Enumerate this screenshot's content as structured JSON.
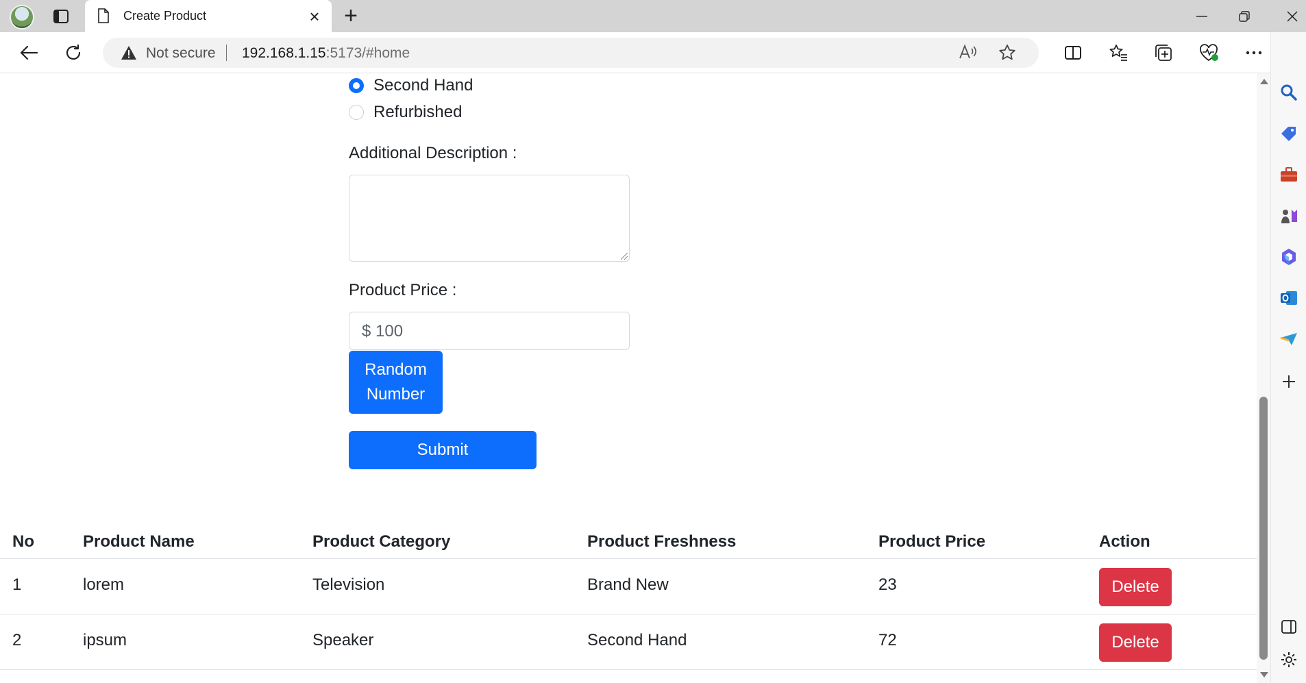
{
  "browser": {
    "tab_title": "Create Product",
    "not_secure_label": "Not secure",
    "url_host": "192.168.1.15",
    "url_rest": ":5173/#home"
  },
  "form": {
    "condition_options": [
      {
        "label": "Second Hand",
        "checked": true
      },
      {
        "label": "Refurbished",
        "checked": false
      }
    ],
    "description_label": "Additional Description :",
    "description_value": "",
    "price_label": "Product Price :",
    "price_value": "$ 100",
    "random_button_line1": "Random",
    "random_button_line2": "Number",
    "submit_label": "Submit"
  },
  "table": {
    "headers": [
      "No",
      "Product Name",
      "Product Category",
      "Product Freshness",
      "Product Price",
      "Action"
    ],
    "rows": [
      {
        "no": "1",
        "name": "lorem",
        "category": "Television",
        "freshness": "Brand New",
        "price": "23",
        "action": "Delete"
      },
      {
        "no": "2",
        "name": "ipsum",
        "category": "Speaker",
        "freshness": "Second Hand",
        "price": "72",
        "action": "Delete"
      }
    ]
  },
  "colors": {
    "primary": "#0d6efd",
    "danger": "#dc3545",
    "tabbar": "#d4d4d4"
  }
}
